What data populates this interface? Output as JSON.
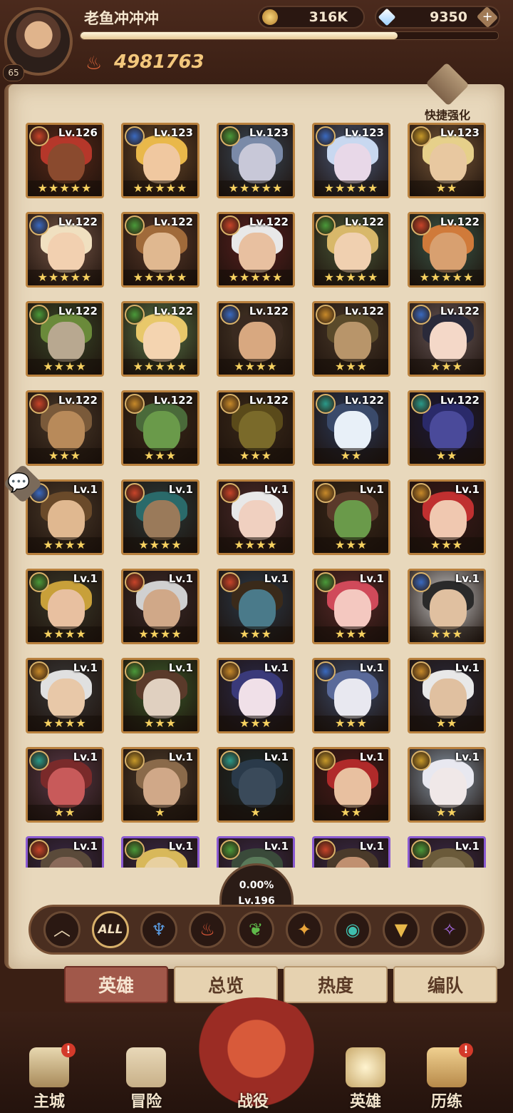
{
  "player": {
    "name": "老鱼冲冲冲",
    "level": "65",
    "power": "4981763",
    "exp_fraction": 0.76
  },
  "currency": {
    "gold": "316K",
    "gems": "9350"
  },
  "quick_strengthen": {
    "label": "快捷强化"
  },
  "total_level": {
    "percent": "0.00%",
    "level": "Lv.196"
  },
  "filters": [
    {
      "name": "collapse",
      "glyph": "︿",
      "color": "#e6d2b0"
    },
    {
      "name": "all",
      "glyph": "ALL",
      "color": "#f1e0c0"
    },
    {
      "name": "water",
      "glyph": "♆",
      "color": "#5a9be0"
    },
    {
      "name": "fire",
      "glyph": "♨",
      "color": "#e35a3a"
    },
    {
      "name": "nature",
      "glyph": "❦",
      "color": "#5fba4a"
    },
    {
      "name": "light",
      "glyph": "✦",
      "color": "#e9a43a"
    },
    {
      "name": "eye",
      "glyph": "◉",
      "color": "#3fbfae"
    },
    {
      "name": "gold",
      "glyph": "▼",
      "color": "#e8b84a"
    },
    {
      "name": "void",
      "glyph": "✧",
      "color": "#a56ae0"
    }
  ],
  "tabs": {
    "heroes": "英雄",
    "overview": "总览",
    "popularity": "热度",
    "formation": "编队"
  },
  "nav": {
    "city": "主城",
    "adventure": "冒险",
    "campaign": "战役",
    "heroes": "英雄",
    "trial": "历练"
  },
  "heroes": [
    {
      "lv": "Lv.126",
      "stars": "★★★★★",
      "faction": "fire",
      "face": "#8a4a2e",
      "hair": "#b5372a",
      "bg": "#5a2a1a"
    },
    {
      "lv": "Lv.123",
      "stars": "★★★★★",
      "faction": "water",
      "face": "#f0c8a0",
      "hair": "#e9b84a",
      "bg": "#6a4a2a"
    },
    {
      "lv": "Lv.123",
      "stars": "★★★★★",
      "faction": "nature",
      "face": "#c8c8d8",
      "hair": "#7a8aa8",
      "bg": "#3a4a5a"
    },
    {
      "lv": "Lv.123",
      "stars": "★★★★★",
      "faction": "water",
      "face": "#e8d8e8",
      "hair": "#c8d8f0",
      "bg": "#4a5a7a"
    },
    {
      "lv": "Lv.123",
      "stars": "★★",
      "faction": "gold",
      "face": "#e8c8a0",
      "hair": "#e6d08a",
      "bg": "#7a5a3a"
    },
    {
      "lv": "Lv.122",
      "stars": "★★★★★",
      "faction": "water",
      "face": "#f2d0b0",
      "hair": "#f0e0c0",
      "bg": "#7a5a4a"
    },
    {
      "lv": "Lv.122",
      "stars": "★★★★★",
      "faction": "nature",
      "face": "#e0b890",
      "hair": "#a06a3a",
      "bg": "#5a3a2a"
    },
    {
      "lv": "Lv.122",
      "stars": "★★★★★",
      "faction": "fire",
      "face": "#e8c0a0",
      "hair": "#e8e8e8",
      "bg": "#5a2020"
    },
    {
      "lv": "Lv.122",
      "stars": "★★★★★",
      "faction": "nature",
      "face": "#f0d0b0",
      "hair": "#d8b86a",
      "bg": "#4a5a3a"
    },
    {
      "lv": "Lv.122",
      "stars": "★★★★★",
      "faction": "fire",
      "face": "#d8a070",
      "hair": "#d07a3a",
      "bg": "#3a5a4a"
    },
    {
      "lv": "Lv.122",
      "stars": "★★★★",
      "faction": "nature",
      "face": "#b8a890",
      "hair": "#6a8a3a",
      "bg": "#3a4a2a"
    },
    {
      "lv": "Lv.122",
      "stars": "★★★★★",
      "faction": "nature",
      "face": "#f4d4b0",
      "hair": "#e8c86a",
      "bg": "#5a7a4a"
    },
    {
      "lv": "Lv.122",
      "stars": "★★★★",
      "faction": "water",
      "face": "#d8a880",
      "hair": "#3a2a20",
      "bg": "#4a3a2a"
    },
    {
      "lv": "Lv.122",
      "stars": "★★★",
      "faction": "light",
      "face": "#b8956a",
      "hair": "#5a4a2a",
      "bg": "#4a3a2a"
    },
    {
      "lv": "Lv.122",
      "stars": "★★★",
      "faction": "water",
      "face": "#f4d8c8",
      "hair": "#2a2a3a",
      "bg": "#6a5a5a"
    },
    {
      "lv": "Lv.122",
      "stars": "★★★",
      "faction": "fire",
      "face": "#b88a5a",
      "hair": "#7a5a3a",
      "bg": "#4a3a2a"
    },
    {
      "lv": "Lv.122",
      "stars": "★★★",
      "faction": "light",
      "face": "#6a9a4a",
      "hair": "#4a6a3a",
      "bg": "#3a2a1a"
    },
    {
      "lv": "Lv.122",
      "stars": "★★★",
      "faction": "light",
      "face": "#7a6a2a",
      "hair": "#5a4a1a",
      "bg": "#3a2a1a"
    },
    {
      "lv": "Lv.122",
      "stars": "★★",
      "faction": "eye",
      "face": "#e8f0f8",
      "hair": "#3a4a6a",
      "bg": "#2a3a5a"
    },
    {
      "lv": "Lv.122",
      "stars": "★★",
      "faction": "eye",
      "face": "#4a4a9a",
      "hair": "#2a2a6a",
      "bg": "#1a1a3a"
    },
    {
      "lv": "Lv.1",
      "stars": "★★★★",
      "faction": "water",
      "face": "#e0b890",
      "hair": "#6a4a2a",
      "bg": "#4a3a2a"
    },
    {
      "lv": "Lv.1",
      "stars": "★★★★",
      "faction": "fire",
      "face": "#9a7a5a",
      "hair": "#2a6a6a",
      "bg": "#2a3a3a"
    },
    {
      "lv": "Lv.1",
      "stars": "★★★★",
      "faction": "fire",
      "face": "#f0d0c0",
      "hair": "#e8e8e8",
      "bg": "#4a2a2a"
    },
    {
      "lv": "Lv.1",
      "stars": "★★★",
      "faction": "light",
      "face": "#6a9a4a",
      "hair": "#5a3a2a",
      "bg": "#3a2a1a"
    },
    {
      "lv": "Lv.1",
      "stars": "★★★",
      "faction": "light",
      "face": "#f0c8b0",
      "hair": "#c03030",
      "bg": "#3a1a1a"
    },
    {
      "lv": "Lv.1",
      "stars": "★★★★",
      "faction": "nature",
      "face": "#e8c0a0",
      "hair": "#c8a03a",
      "bg": "#3a3a2a"
    },
    {
      "lv": "Lv.1",
      "stars": "★★★★",
      "faction": "fire",
      "face": "#d0a888",
      "hair": "#d0d0d0",
      "bg": "#3a2a2a"
    },
    {
      "lv": "Lv.1",
      "stars": "★★★",
      "faction": "fire",
      "face": "#4a7a8a",
      "hair": "#3a2a1a",
      "bg": "#2a3a4a"
    },
    {
      "lv": "Lv.1",
      "stars": "★★★",
      "faction": "nature",
      "face": "#f4c8c0",
      "hair": "#d04a5a",
      "bg": "#5a2a2a"
    },
    {
      "lv": "Lv.1",
      "stars": "★★★",
      "faction": "water",
      "face": "#e0c0a0",
      "hair": "#2a2a2a",
      "bg": "#c8c8c8"
    },
    {
      "lv": "Lv.1",
      "stars": "★★★★",
      "faction": "light",
      "face": "#e8c8a8",
      "hair": "#e0e0e0",
      "bg": "#3a3a3a"
    },
    {
      "lv": "Lv.1",
      "stars": "★★★",
      "faction": "nature",
      "face": "#e0d0c0",
      "hair": "#5a3a2a",
      "bg": "#3a5a2a"
    },
    {
      "lv": "Lv.1",
      "stars": "★★★",
      "faction": "light",
      "face": "#f0e0e8",
      "hair": "#3a3a7a",
      "bg": "#2a2a4a"
    },
    {
      "lv": "Lv.1",
      "stars": "★★★",
      "faction": "water",
      "face": "#e8e8f0",
      "hair": "#5a6a9a",
      "bg": "#3a4a6a"
    },
    {
      "lv": "Lv.1",
      "stars": "★★",
      "faction": "light",
      "face": "#e0c0a0",
      "hair": "#e8e8e8",
      "bg": "#2a2a3a"
    },
    {
      "lv": "Lv.1",
      "stars": "★★",
      "faction": "eye",
      "face": "#c85a5a",
      "hair": "#7a2a2a",
      "bg": "#5a3a4a"
    },
    {
      "lv": "Lv.1",
      "stars": "★",
      "faction": "gold",
      "face": "#d0a888",
      "hair": "#8a6a4a",
      "bg": "#4a3a2a"
    },
    {
      "lv": "Lv.1",
      "stars": "★",
      "faction": "eye",
      "face": "#3a4a5a",
      "hair": "#2a3a4a",
      "bg": "#1a2a2a"
    },
    {
      "lv": "Lv.1",
      "stars": "★★",
      "faction": "gold",
      "face": "#e8c0a0",
      "hair": "#b02a2a",
      "bg": "#4a1a1a"
    },
    {
      "lv": "Lv.1",
      "stars": "★★",
      "faction": "gold",
      "face": "#f0e8e8",
      "hair": "#e8e8f0",
      "bg": "#8a9aaa"
    },
    {
      "lv": "Lv.1",
      "stars": "",
      "faction": "fire",
      "face": "#8a6a5a",
      "hair": "#5a4a3a",
      "bg": "#3a2a4a",
      "purple": true
    },
    {
      "lv": "Lv.1",
      "stars": "",
      "faction": "nature",
      "face": "#e8d0a0",
      "hair": "#d8b85a",
      "bg": "#3a2a4a",
      "purple": true
    },
    {
      "lv": "Lv.1",
      "stars": "",
      "faction": "nature",
      "face": "#5a7a5a",
      "hair": "#3a4a3a",
      "bg": "#3a2a4a",
      "purple": true
    },
    {
      "lv": "Lv.1",
      "stars": "",
      "faction": "fire",
      "face": "#c09070",
      "hair": "#4a3a2a",
      "bg": "#3a2a4a",
      "purple": true
    },
    {
      "lv": "Lv.1",
      "stars": "",
      "faction": "nature",
      "face": "#8a7a5a",
      "hair": "#6a5a3a",
      "bg": "#3a2a4a",
      "purple": true
    }
  ],
  "faction_colors": {
    "fire": "#c8442a",
    "water": "#3a6ac0",
    "nature": "#4a9a3a",
    "light": "#c88a2a",
    "eye": "#2a9a8a",
    "gold": "#c89a2a"
  }
}
